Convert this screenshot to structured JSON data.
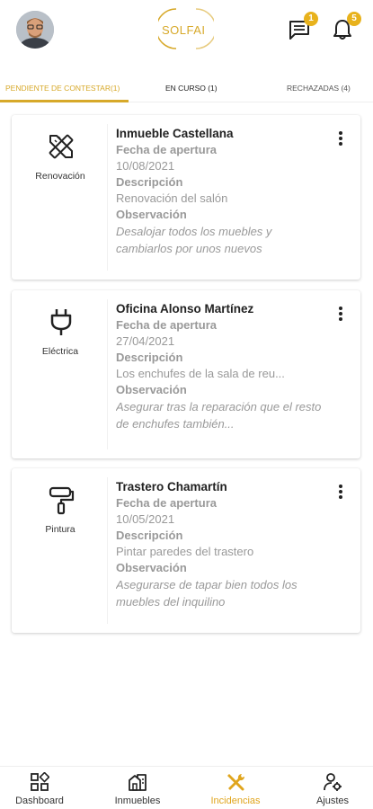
{
  "header": {
    "logo_text": "SOLFAI",
    "messages_badge": "1",
    "notifications_badge": "5",
    "accent": "#d7a92a"
  },
  "tabs": [
    {
      "label": "PENDIENTE DE CONTESTAR(1)",
      "active": true
    },
    {
      "label": "EN CURSO (1)",
      "active": false
    },
    {
      "label": "RECHAZADAS (4)",
      "active": false
    }
  ],
  "cards": [
    {
      "icon": "renovation-tools-icon",
      "category": "Renovación",
      "title": "Inmueble Castellana",
      "date_label": "Fecha de apertura",
      "date": "10/08/2021",
      "desc_label": "Descripción",
      "desc": "Renovación del salón",
      "obs_label": "Observación",
      "obs": "Desalojar todos los muebles y cambiarlos por unos nuevos"
    },
    {
      "icon": "electric-plug-icon",
      "category": "Eléctrica",
      "title": "Oficina Alonso Martínez",
      "date_label": "Fecha de apertura",
      "date": "27/04/2021",
      "desc_label": "Descripción",
      "desc": "Los enchufes de la sala de reu...",
      "obs_label": "Observación",
      "obs": "Asegurar tras la reparación que el resto de enchufes también..."
    },
    {
      "icon": "paint-roller-icon",
      "category": "Pintura",
      "title": "Trastero Chamartín",
      "date_label": "Fecha de apertura",
      "date": "10/05/2021",
      "desc_label": "Descripción",
      "desc": "Pintar paredes del trastero",
      "obs_label": "Observación",
      "obs": "Asegurarse de tapar bien todos los muebles del inquilino"
    }
  ],
  "bottom_nav": [
    {
      "label": "Dashboard",
      "icon": "dashboard-icon",
      "active": false
    },
    {
      "label": "Inmuebles",
      "icon": "buildings-icon",
      "active": false
    },
    {
      "label": "Incidencias",
      "icon": "tools-icon",
      "active": true
    },
    {
      "label": "Ajustes",
      "icon": "user-settings-icon",
      "active": false
    }
  ]
}
